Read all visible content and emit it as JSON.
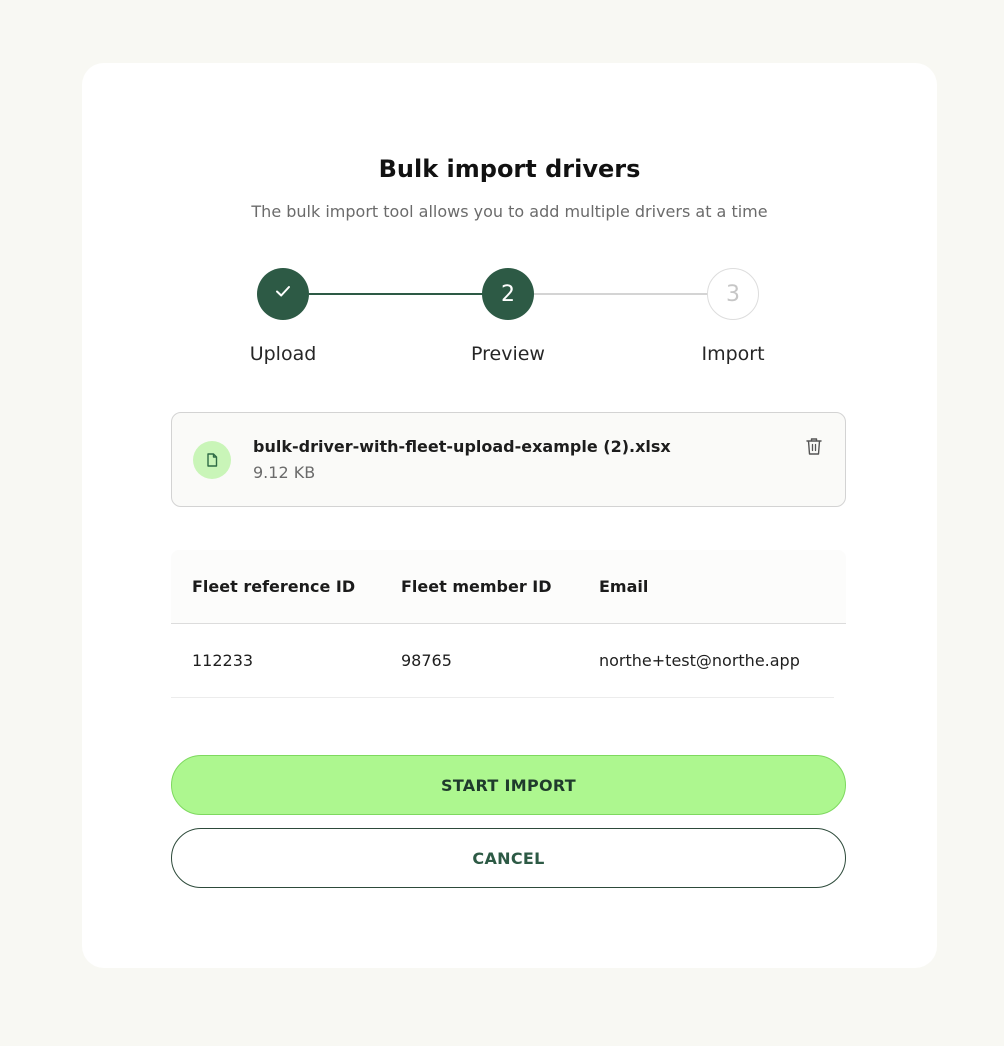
{
  "modal": {
    "title": "Bulk import drivers",
    "subtitle": "The bulk import tool allows you to add multiple drivers at a time"
  },
  "stepper": {
    "steps": [
      {
        "label": "Upload",
        "number": "1",
        "status": "completed",
        "icon": "check-icon"
      },
      {
        "label": "Preview",
        "number": "2",
        "status": "active"
      },
      {
        "label": "Import",
        "number": "3",
        "status": "pending"
      }
    ]
  },
  "file": {
    "name": "bulk-driver-with-fleet-upload-example (2).xlsx",
    "size": "9.12 KB",
    "icon": "file-icon",
    "delete_icon": "trash-icon"
  },
  "table": {
    "columns": [
      "Fleet reference ID",
      "Fleet member ID",
      "Email"
    ],
    "rows": [
      [
        "112233",
        "98765",
        "northe+test@northe.app"
      ]
    ]
  },
  "actions": {
    "start_import": "START IMPORT",
    "cancel": "CANCEL"
  },
  "colors": {
    "primary_dark": "#2d5a45",
    "accent_green": "#adf78f",
    "background": "#f8f8f3"
  }
}
